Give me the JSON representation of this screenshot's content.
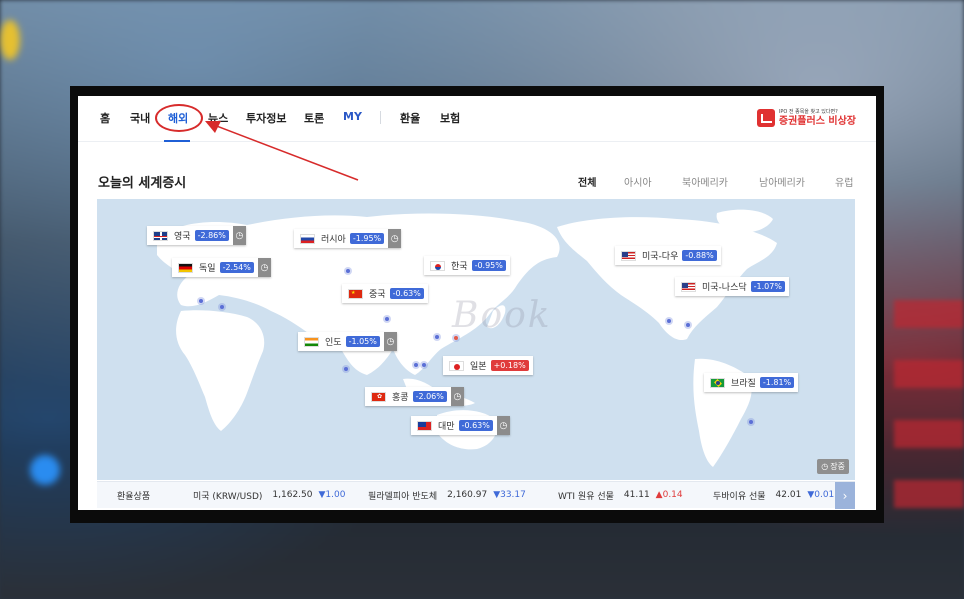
{
  "nav": {
    "items": [
      {
        "label": "홈"
      },
      {
        "label": "국내"
      },
      {
        "label": "해외"
      },
      {
        "label": "뉴스"
      },
      {
        "label": "투자정보"
      },
      {
        "label": "토론"
      },
      {
        "label": "MY"
      },
      {
        "label": "환율"
      },
      {
        "label": "보험"
      }
    ],
    "active": "해외"
  },
  "promo": {
    "small_text": "IPO 전 종목을 찾고 있다면?",
    "big_text": "증권플러스 비상장"
  },
  "section": {
    "title": "오늘의 세계증시",
    "region_tabs": [
      "전체",
      "아시아",
      "북아메리카",
      "남아메리카",
      "유럽"
    ],
    "active_tab": "전체"
  },
  "markets": [
    {
      "name": "영국",
      "change": "-2.86%",
      "direction": "down",
      "clock": true
    },
    {
      "name": "독일",
      "change": "-2.54%",
      "direction": "down",
      "clock": true
    },
    {
      "name": "러시아",
      "change": "-1.95%",
      "direction": "down",
      "clock": true
    },
    {
      "name": "한국",
      "change": "-0.95%",
      "direction": "down",
      "clock": false
    },
    {
      "name": "중국",
      "change": "-0.63%",
      "direction": "down",
      "clock": false
    },
    {
      "name": "인도",
      "change": "-1.05%",
      "direction": "down",
      "clock": true
    },
    {
      "name": "일본",
      "change": "+0.18%",
      "direction": "up",
      "clock": false
    },
    {
      "name": "홍콩",
      "change": "-2.06%",
      "direction": "down",
      "clock": true
    },
    {
      "name": "대만",
      "change": "-0.63%",
      "direction": "down",
      "clock": true
    },
    {
      "name": "미국-다우",
      "change": "-0.88%",
      "direction": "down",
      "clock": false
    },
    {
      "name": "미국-나스닥",
      "change": "-1.07%",
      "direction": "down",
      "clock": false
    },
    {
      "name": "브라질",
      "change": "-1.81%",
      "direction": "down",
      "clock": false
    }
  ],
  "map_badge": "장중",
  "watermark": "Book",
  "ticker": {
    "category": "환율상품",
    "items": [
      {
        "name": "미국 (KRW/USD)",
        "value": "1,162.50",
        "change": "▼1.00",
        "direction": "down"
      },
      {
        "name": "필라델피아 반도체",
        "value": "2,160.97",
        "change": "▼33.17",
        "direction": "down"
      },
      {
        "name": "WTI 원유 선물",
        "value": "41.11",
        "change": "▲0.14",
        "direction": "up"
      },
      {
        "name": "두바이유 선물",
        "value": "42.01",
        "change": "▼0.01",
        "direction": "down"
      }
    ],
    "next_icon": "chevron-right-icon"
  },
  "colors": {
    "accent": "#1f5fd6",
    "down": "#3f6ad8",
    "up": "#e03b3b",
    "annotation": "#d72b2b"
  }
}
